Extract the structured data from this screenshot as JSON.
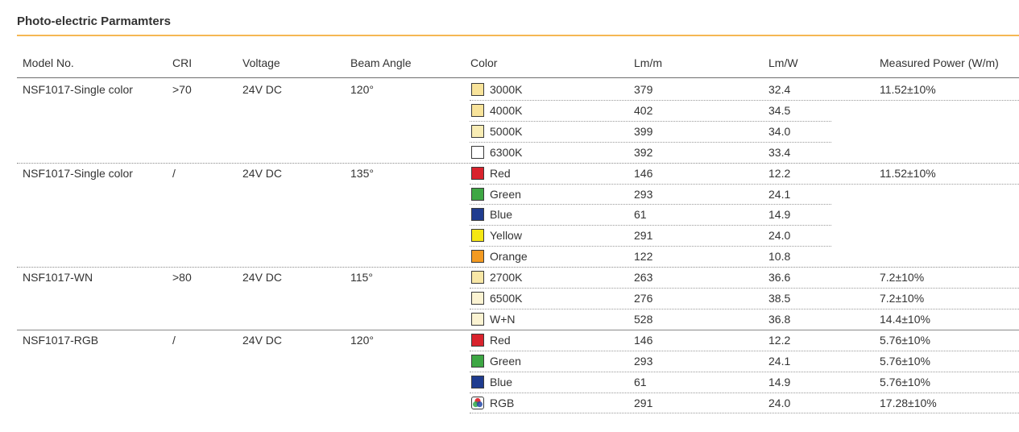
{
  "title": "Photo-electric Parmamters",
  "colors": {
    "accent": "#f5b754"
  },
  "headers": {
    "model": "Model No.",
    "cri": "CRI",
    "voltage": "Voltage",
    "beam": "Beam Angle",
    "color": "Color",
    "lmm": "Lm/m",
    "lmw": "Lm/W",
    "power": "Measured Power (W/m)"
  },
  "groups": [
    {
      "model": "NSF1017-Single color",
      "cri": ">70",
      "voltage": "24V DC",
      "beam": "120°",
      "rows": [
        {
          "color": "3000K",
          "swatch": "#f8e39a",
          "lmm": "379",
          "lmw": "32.4",
          "power": "11.52±10%"
        },
        {
          "color": "4000K",
          "swatch": "#f8e39a",
          "lmm": "402",
          "lmw": "34.5",
          "power": ""
        },
        {
          "color": "5000K",
          "swatch": "#f8ecb4",
          "lmm": "399",
          "lmw": "34.0",
          "power": ""
        },
        {
          "color": "6300K",
          "swatch": "#ffffff",
          "lmm": "392",
          "lmw": "33.4",
          "power": ""
        }
      ]
    },
    {
      "model": "NSF1017-Single color",
      "cri": "/",
      "voltage": "24V DC",
      "beam": "135°",
      "rows": [
        {
          "color": "Red",
          "swatch": "#d9232d",
          "lmm": "146",
          "lmw": "12.2",
          "power": "11.52±10%"
        },
        {
          "color": "Green",
          "swatch": "#3ea744",
          "lmm": "293",
          "lmw": "24.1",
          "power": ""
        },
        {
          "color": "Blue",
          "swatch": "#1f3c8f",
          "lmm": "61",
          "lmw": "14.9",
          "power": ""
        },
        {
          "color": "Yellow",
          "swatch": "#f5e714",
          "lmm": "291",
          "lmw": "24.0",
          "power": ""
        },
        {
          "color": "Orange",
          "swatch": "#f39a21",
          "lmm": "122",
          "lmw": "10.8",
          "power": ""
        }
      ]
    },
    {
      "model": "NSF1017-WN",
      "cri": ">80",
      "voltage": "24V DC",
      "beam": "115°",
      "rows": [
        {
          "color": "2700K",
          "swatch": "#f8e7a6",
          "lmm": "263",
          "lmw": "36.6",
          "power": "7.2±10%"
        },
        {
          "color": "6500K",
          "swatch": "#fbf3d2",
          "lmm": "276",
          "lmw": "38.5",
          "power": "7.2±10%"
        },
        {
          "color": "W+N",
          "swatch": "#fbf3d2",
          "lmm": "528",
          "lmw": "36.8",
          "power": "14.4±10%"
        }
      ]
    },
    {
      "model": "NSF1017-RGB",
      "cri": "/",
      "voltage": "24V DC",
      "beam": "120°",
      "rows": [
        {
          "color": "Red",
          "swatch": "#d9232d",
          "lmm": "146",
          "lmw": "12.2",
          "power": "5.76±10%"
        },
        {
          "color": "Green",
          "swatch": "#3ea744",
          "lmm": "293",
          "lmw": "24.1",
          "power": "5.76±10%"
        },
        {
          "color": "Blue",
          "swatch": "#1f3c8f",
          "lmm": "61",
          "lmw": "14.9",
          "power": "5.76±10%"
        },
        {
          "color": "RGB",
          "swatch": "rgb-wheel",
          "lmm": "291",
          "lmw": "24.0",
          "power": "17.28±10%"
        }
      ]
    }
  ]
}
